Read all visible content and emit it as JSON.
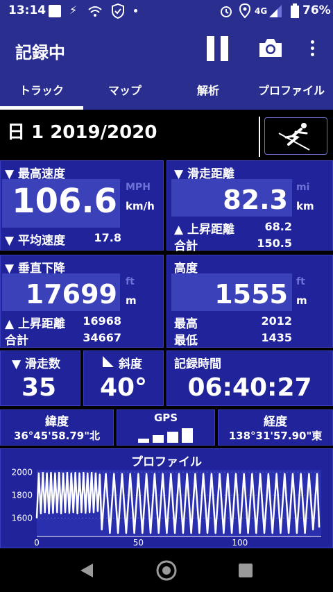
{
  "status": {
    "time": "13:14",
    "network": "4G",
    "battery": "76%"
  },
  "app": {
    "title": "記録中",
    "tabs": [
      {
        "label": "トラック",
        "active": true
      },
      {
        "label": "マップ",
        "active": false
      },
      {
        "label": "解析",
        "active": false
      },
      {
        "label": "プロファイル",
        "active": false
      }
    ]
  },
  "day": {
    "label": "日 1 2019/2020"
  },
  "max_speed": {
    "label": "▼ 最高速度",
    "value": "106.6",
    "unit_inactive": "MPH",
    "unit_active": "km/h",
    "avg_label": "▼ 平均速度",
    "avg_value": "17.8"
  },
  "ski_distance": {
    "label": "▼ 滑走距離",
    "value": "82.3",
    "unit_inactive": "mi",
    "unit_active": "km",
    "ascent_label": "▲ 上昇距離",
    "ascent_value": "68.2",
    "total_label": "合計",
    "total_value": "150.5"
  },
  "vertical_descent": {
    "label": "▼ 垂直下降",
    "value": "17699",
    "unit_inactive": "ft",
    "unit_active": "m",
    "ascent_label": "▲ 上昇距離",
    "ascent_value": "16968",
    "total_label": "合計",
    "total_value": "34667"
  },
  "altitude": {
    "label": "高度",
    "value": "1555",
    "unit_inactive": "ft",
    "unit_active": "m",
    "max_label": "最高",
    "max_value": "2012",
    "min_label": "最低",
    "min_value": "1435"
  },
  "runs": {
    "label": "▼ 滑走数",
    "value": "35"
  },
  "slope": {
    "label": "斜度",
    "value": "40°"
  },
  "record_time": {
    "label": "記録時間",
    "value": "06:40:27"
  },
  "gps": {
    "lat_label": "緯度",
    "lat_value": "36°45'58.79\"北",
    "gps_label": "GPS",
    "signal_bars": 4,
    "lon_label": "経度",
    "lon_value": "138°31'57.90\"東"
  },
  "chart_data": {
    "type": "line",
    "title": "プロファイル",
    "xlabel": "",
    "ylabel": "",
    "x_ticks": [
      "0",
      "50",
      "100"
    ],
    "y_ticks": [
      "1600",
      "1800",
      "2000"
    ],
    "xlim": [
      0,
      140
    ],
    "ylim": [
      1440,
      2020
    ],
    "series": [
      {
        "values_description_free": true,
        "points": [
          [
            0,
            1600
          ],
          [
            1,
            1990
          ],
          [
            2,
            1640
          ],
          [
            3,
            1995
          ],
          [
            4,
            1650
          ],
          [
            5,
            1990
          ],
          [
            6,
            1640
          ],
          [
            7,
            1995
          ],
          [
            8,
            1645
          ],
          [
            9,
            1990
          ],
          [
            10,
            1650
          ],
          [
            11,
            1995
          ],
          [
            12,
            1640
          ],
          [
            13,
            1990
          ],
          [
            14,
            1650
          ],
          [
            15,
            1995
          ],
          [
            16,
            1645
          ],
          [
            17,
            1990
          ],
          [
            18,
            1650
          ],
          [
            19,
            1995
          ],
          [
            20,
            1640
          ],
          [
            21,
            1990
          ],
          [
            22,
            1650
          ],
          [
            23,
            1995
          ],
          [
            24,
            1645
          ],
          [
            25,
            1990
          ],
          [
            26,
            1650
          ],
          [
            27,
            1995
          ],
          [
            28,
            1650
          ],
          [
            29,
            1990
          ],
          [
            30,
            1660
          ],
          [
            31,
            1980
          ],
          [
            32,
            1500
          ],
          [
            34,
            1985
          ],
          [
            36,
            1470
          ],
          [
            38,
            1985
          ],
          [
            40,
            1470
          ],
          [
            42,
            1985
          ],
          [
            44,
            1470
          ],
          [
            46,
            1985
          ],
          [
            48,
            1470
          ],
          [
            50,
            1985
          ],
          [
            52,
            1470
          ],
          [
            54,
            1985
          ],
          [
            56,
            1470
          ],
          [
            58,
            1985
          ],
          [
            60,
            1470
          ],
          [
            62,
            1985
          ],
          [
            64,
            1470
          ],
          [
            66,
            1985
          ],
          [
            68,
            1470
          ],
          [
            70,
            1985
          ],
          [
            72,
            1470
          ],
          [
            74,
            1985
          ],
          [
            76,
            1470
          ],
          [
            78,
            1985
          ],
          [
            80,
            1470
          ],
          [
            82,
            1985
          ],
          [
            84,
            1470
          ],
          [
            86,
            1985
          ],
          [
            88,
            1470
          ],
          [
            90,
            1985
          ],
          [
            92,
            1470
          ],
          [
            94,
            1985
          ],
          [
            96,
            1470
          ],
          [
            98,
            1985
          ],
          [
            100,
            1470
          ],
          [
            102,
            1985
          ],
          [
            104,
            1470
          ],
          [
            106,
            1985
          ],
          [
            108,
            1470
          ],
          [
            110,
            1985
          ],
          [
            112,
            1470
          ],
          [
            114,
            1985
          ],
          [
            116,
            1470
          ],
          [
            118,
            1985
          ],
          [
            120,
            1470
          ],
          [
            122,
            1985
          ],
          [
            124,
            1470
          ],
          [
            126,
            1985
          ],
          [
            128,
            1470
          ],
          [
            130,
            1985
          ],
          [
            132,
            1470
          ],
          [
            134,
            1985
          ],
          [
            136,
            1500
          ],
          [
            138,
            1985
          ],
          [
            139,
            1520
          ]
        ]
      }
    ]
  }
}
